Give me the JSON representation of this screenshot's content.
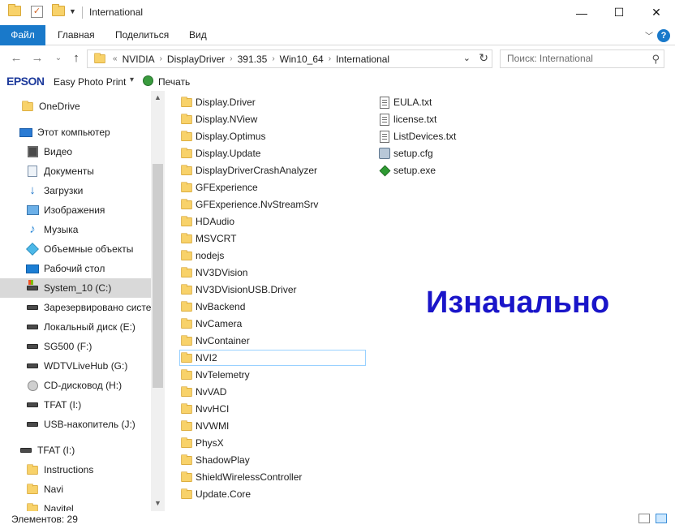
{
  "window": {
    "title": "International",
    "minimize": "—",
    "maximize": "☐",
    "close": "✕"
  },
  "ribbon": {
    "tabs": [
      "Файл",
      "Главная",
      "Поделиться",
      "Вид"
    ],
    "help": "?"
  },
  "address": {
    "crumbs": [
      "NVIDIA",
      "DisplayDriver",
      "391.35",
      "Win10_64",
      "International"
    ],
    "overflow": "«",
    "search_placeholder": "Поиск: International"
  },
  "epson": {
    "logo": "EPSON",
    "app": "Easy Photo Print",
    "print": "Печать"
  },
  "nav": {
    "items": [
      {
        "label": "OneDrive",
        "icon": "folder-icon"
      },
      {
        "label": "Этот компьютер",
        "icon": "computer-icon"
      },
      {
        "label": "Видео",
        "icon": "video-icon"
      },
      {
        "label": "Документы",
        "icon": "documents-icon"
      },
      {
        "label": "Загрузки",
        "icon": "downloads-icon"
      },
      {
        "label": "Изображения",
        "icon": "images-icon"
      },
      {
        "label": "Музыка",
        "icon": "music-icon"
      },
      {
        "label": "Объемные объекты",
        "icon": "3d-objects-icon"
      },
      {
        "label": "Рабочий стол",
        "icon": "desktop-icon"
      },
      {
        "label": "System_10 (C:)",
        "icon": "system-drive-icon"
      },
      {
        "label": "Зарезервировано системой",
        "icon": "drive-icon"
      },
      {
        "label": "Локальный диск (E:)",
        "icon": "drive-icon"
      },
      {
        "label": "SG500 (F:)",
        "icon": "drive-icon"
      },
      {
        "label": "WDTVLiveHub (G:)",
        "icon": "drive-icon"
      },
      {
        "label": "CD-дисковод (H:)",
        "icon": "cd-drive-icon"
      },
      {
        "label": "TFAT (I:)",
        "icon": "drive-icon"
      },
      {
        "label": "USB-накопитель (J:)",
        "icon": "drive-icon"
      },
      {
        "label": "TFAT (I:)",
        "icon": "drive-icon"
      },
      {
        "label": "Instructions",
        "icon": "folder-icon"
      },
      {
        "label": "Navi",
        "icon": "folder-icon"
      },
      {
        "label": "Navitel",
        "icon": "folder-icon"
      }
    ],
    "selected_index": 9
  },
  "files": {
    "folders": [
      "Display.Driver",
      "Display.NView",
      "Display.Optimus",
      "Display.Update",
      "DisplayDriverCrashAnalyzer",
      "GFExperience",
      "GFExperience.NvStreamSrv",
      "HDAudio",
      "MSVCRT",
      "nodejs",
      "NV3DVision",
      "NV3DVisionUSB.Driver",
      "NvBackend",
      "NvCamera",
      "NvContainer",
      "NVI2",
      "NvTelemetry",
      "NvVAD",
      "NvvHCI",
      "NVWMI",
      "PhysX",
      "ShadowPlay",
      "ShieldWirelessController",
      "Update.Core"
    ],
    "focused_index": 15,
    "other": [
      {
        "label": "EULA.txt",
        "icon": "text-file-icon"
      },
      {
        "label": "license.txt",
        "icon": "text-file-icon"
      },
      {
        "label": "ListDevices.txt",
        "icon": "text-file-icon"
      },
      {
        "label": "setup.cfg",
        "icon": "config-file-icon"
      },
      {
        "label": "setup.exe",
        "icon": "nvidia-setup-icon"
      }
    ]
  },
  "overlay_text": "Изначально",
  "status": {
    "items": "Элементов: 29"
  }
}
